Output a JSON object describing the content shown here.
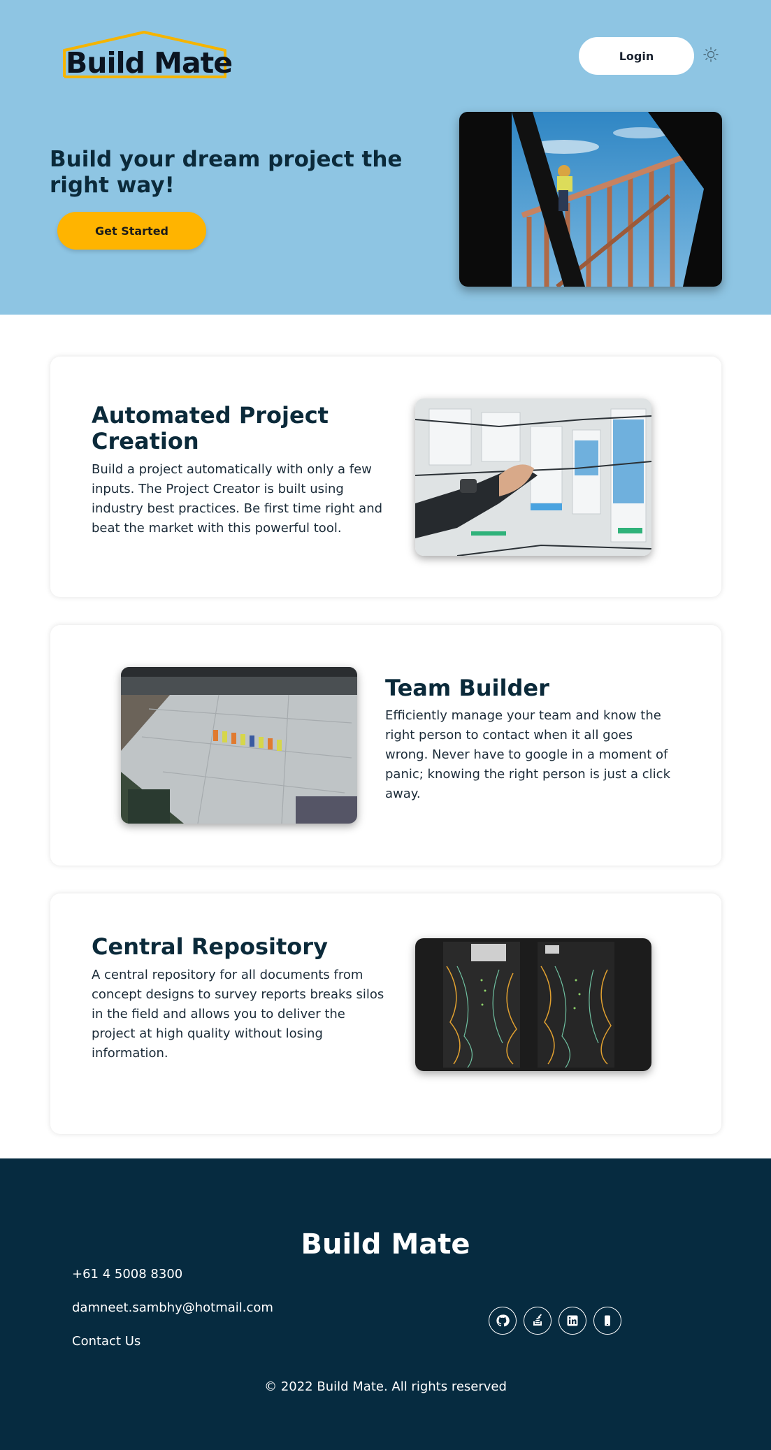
{
  "header": {
    "logo_text": "Build Mate",
    "login_label": "Login",
    "theme_icon": "sun-icon"
  },
  "hero": {
    "title": "Build your dream project the right way!",
    "cta_label": "Get Started"
  },
  "features": [
    {
      "title": "Automated Project Creation",
      "text": "Build a project automatically with only a few inputs. The Project Creator is built using industry best practices. Be first time right and beat the market with this powerful tool."
    },
    {
      "title": "Team Builder",
      "text": "Efficiently manage your team and know the right person to contact when it all goes wrong. Never have to google in a moment of panic; knowing the right person is just a click away."
    },
    {
      "title": "Central Repository",
      "text": "A central repository for all documents from concept designs to survey reports breaks silos in the field and allows you to deliver the project at high quality without losing information."
    }
  ],
  "footer": {
    "brand": "Build Mate",
    "phone": "+61 4 5008 8300",
    "email": "damneet.sambhy@hotmail.com",
    "contact": "Contact Us",
    "copyright": "© 2022 Build Mate. All rights reserved",
    "socials": [
      "github-icon",
      "stack-overflow-icon",
      "linkedin-icon",
      "mobile-icon"
    ]
  },
  "colors": {
    "hero_bg": "#8ec5e3",
    "accent": "#ffb400",
    "footer_bg": "#062b40",
    "text_dark": "#0b2a3a"
  }
}
